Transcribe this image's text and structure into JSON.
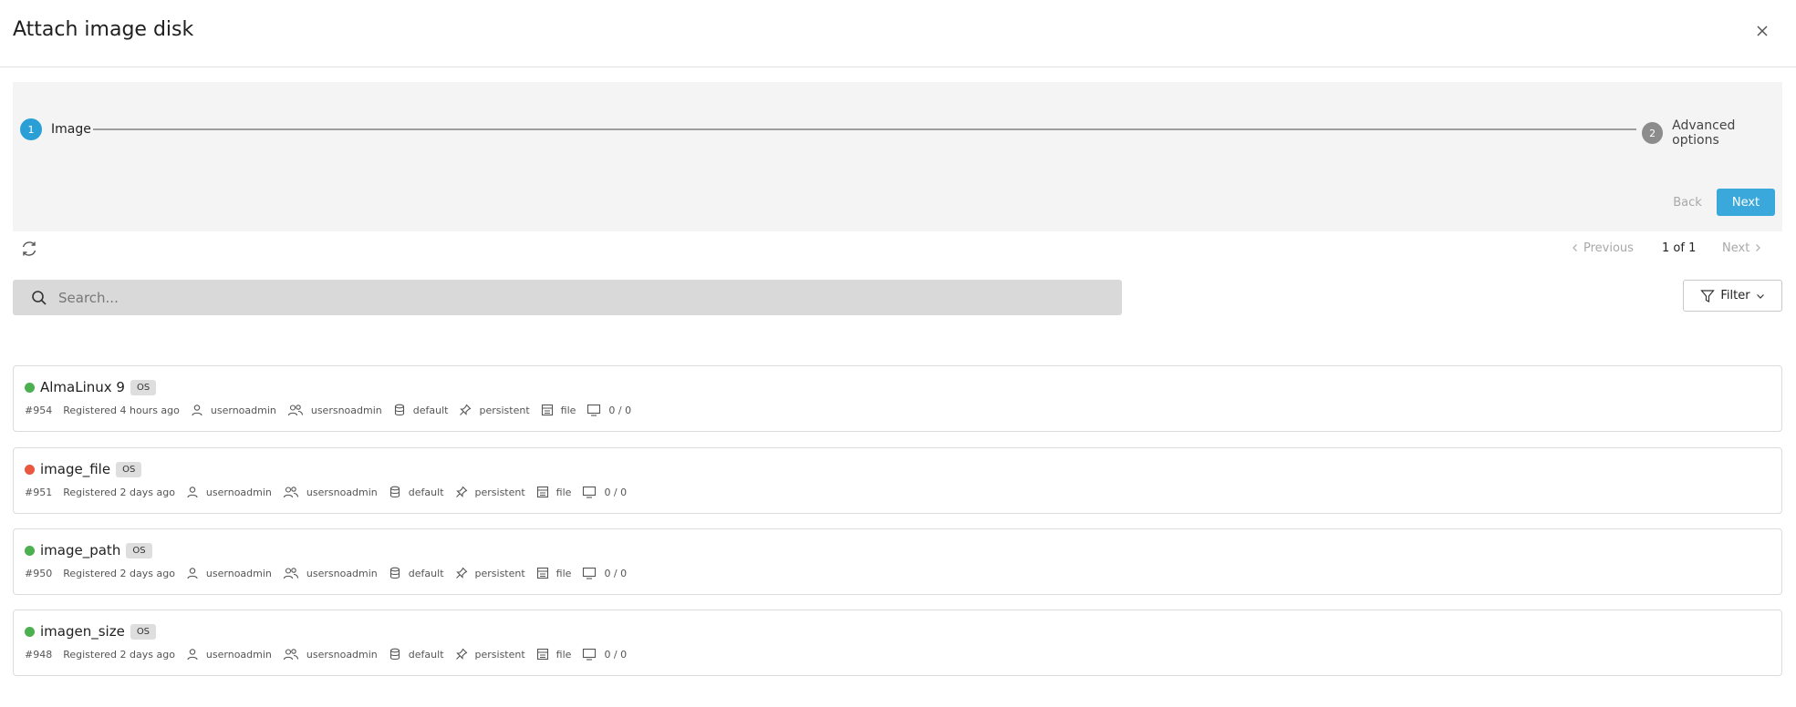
{
  "dialog": {
    "title": "Attach image disk"
  },
  "stepper": {
    "steps": [
      {
        "number": "1",
        "label": "Image"
      },
      {
        "number": "2",
        "label": "Advanced options"
      }
    ],
    "back_label": "Back",
    "next_label": "Next"
  },
  "pagination": {
    "previous": "Previous",
    "count": "1 of 1",
    "next": "Next"
  },
  "search": {
    "placeholder": "Search..."
  },
  "filter": {
    "label": "Filter"
  },
  "colors": {
    "accent": "#3aa8db",
    "status_ready": "#4caf50",
    "status_error": "#e9573f"
  },
  "images": [
    {
      "name": "AlmaLinux 9",
      "badge": "OS",
      "status": "ready",
      "id": "#954",
      "registered": "Registered 4 hours ago",
      "owner": "usernoadmin",
      "group": "usersnoadmin",
      "datastore": "default",
      "persistence": "persistent",
      "type": "file",
      "vms": "0 / 0"
    },
    {
      "name": "image_file",
      "badge": "OS",
      "status": "error",
      "id": "#951",
      "registered": "Registered 2 days ago",
      "owner": "usernoadmin",
      "group": "usersnoadmin",
      "datastore": "default",
      "persistence": "persistent",
      "type": "file",
      "vms": "0 / 0"
    },
    {
      "name": "image_path",
      "badge": "OS",
      "status": "ready",
      "id": "#950",
      "registered": "Registered 2 days ago",
      "owner": "usernoadmin",
      "group": "usersnoadmin",
      "datastore": "default",
      "persistence": "persistent",
      "type": "file",
      "vms": "0 / 0"
    },
    {
      "name": "imagen_size",
      "badge": "OS",
      "status": "ready",
      "id": "#948",
      "registered": "Registered 2 days ago",
      "owner": "usernoadmin",
      "group": "usersnoadmin",
      "datastore": "default",
      "persistence": "persistent",
      "type": "file",
      "vms": "0 / 0"
    }
  ]
}
